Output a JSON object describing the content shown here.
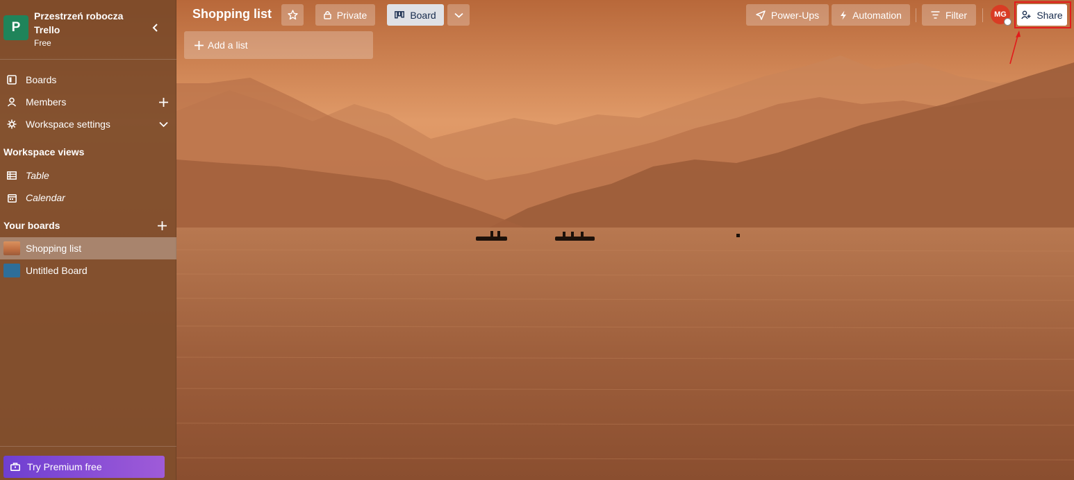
{
  "workspace": {
    "logo_letter": "P",
    "name": "Przestrzeń robocza Trello",
    "plan": "Free"
  },
  "nav": {
    "boards": "Boards",
    "members": "Members",
    "workspace_settings": "Workspace settings"
  },
  "views": {
    "title": "Workspace views",
    "table": "Table",
    "calendar": "Calendar"
  },
  "your_boards": {
    "title": "Your boards",
    "items": [
      {
        "label": "Shopping list",
        "active": true
      },
      {
        "label": "Untitled Board",
        "active": false
      }
    ]
  },
  "premium": {
    "label": "Try Premium free"
  },
  "board": {
    "title": "Shopping list",
    "visibility": "Private",
    "view": "Board",
    "add_list": "Add a list"
  },
  "toolbar": {
    "power_ups": "Power-Ups",
    "automation": "Automation",
    "filter": "Filter",
    "share": "Share"
  },
  "user": {
    "initials": "MG"
  },
  "colors": {
    "sidebar": "#784828",
    "logo": "#1f845a",
    "avatar": "#d93c24",
    "premium_start": "#6e3fd1",
    "premium_end": "#9f5bd8",
    "annotation": "#e21b1b"
  }
}
